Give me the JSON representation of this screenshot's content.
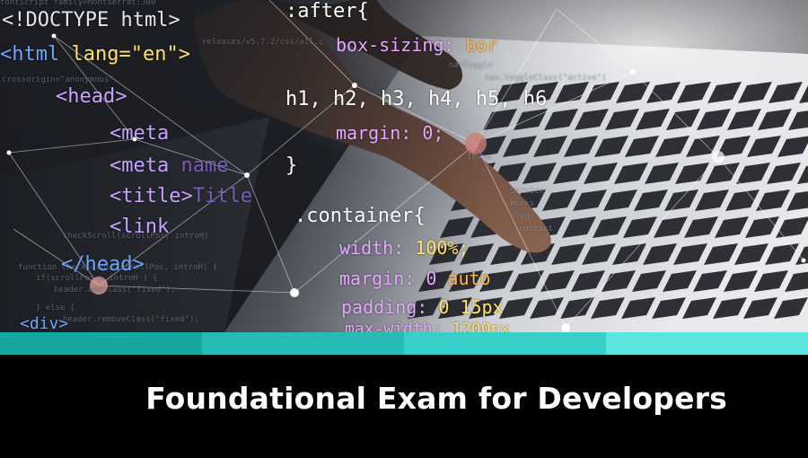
{
  "banner": {
    "title": "Foundational Exam for Developers"
  },
  "stripe": {
    "colors": [
      "#16a8a0",
      "#26bcb5",
      "#36d0c9",
      "#5ae6df"
    ]
  },
  "code": {
    "doctype": "<!DOCTYPE html>",
    "html_open": "<html",
    "lang_attr": "lang=",
    "lang_value": "\"en\">",
    "head_open": "<head>",
    "meta1": "<meta",
    "meta2": "<meta",
    "meta2_attr": "name",
    "title_tag": "<title>",
    "title_text": "Title",
    "link_tag": "<link",
    "head_close": "</head>",
    "div_tag": "<div>",
    "after_sel": ":after{",
    "box_sizing": "box-sizing:",
    "box_sizing_val": "bor",
    "headings": "h1, h2, h3, h4, h5, h6",
    "margin0": "margin: 0;",
    "brace_close": "}",
    "container": ".container{",
    "width": "width:",
    "width_val": "100%;",
    "margin_auto": "margin: 0",
    "margin_auto_val": "auto",
    "padding": "padding:",
    "padding_val": "0 15px",
    "maxwidth": "max-width:",
    "maxwidth_val": "1200px",
    "faint1": "fontScript family=Montserrat:300",
    "faint2": "releases/v5.7.2/css/all.c",
    "faint3": "crossorigin=\"anonymous\"",
    "faint4": "checkScroll(scrollPos, introH)",
    "faint5": "function checkScroll(scrollPos, introH) {",
    "faint6": "if(scrollPos > introH ) {",
    "faint7": "header.addClass(\"fixed\");",
    "faint8": "} else {",
    "faint9": "header.removeClass(\"fixed\");",
    "faint10": "navToggle",
    "faint11": "nav.toggleClass(\"active\")",
    "faint12": "Service",
    "faint13": "Works",
    "faint14": "blog",
    "faint15": "contact",
    "faint16": "lorem"
  }
}
